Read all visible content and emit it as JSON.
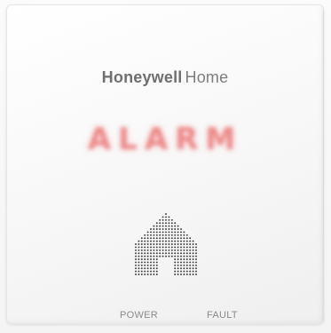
{
  "brand": {
    "name_bold": "Honeywell",
    "name_light": "Home"
  },
  "display": {
    "status_text": "ALARM",
    "status_color": "#e86262"
  },
  "indicators": {
    "power_label": "POWER",
    "fault_label": "FAULT"
  },
  "colors": {
    "panel": "#f7f7f7",
    "brand_text": "#7a7a7a",
    "label_text": "#8a8a8a",
    "grille_dots": "#3a3a3a"
  },
  "icons": {
    "speaker_grille": "house-arrow-grille-icon"
  }
}
